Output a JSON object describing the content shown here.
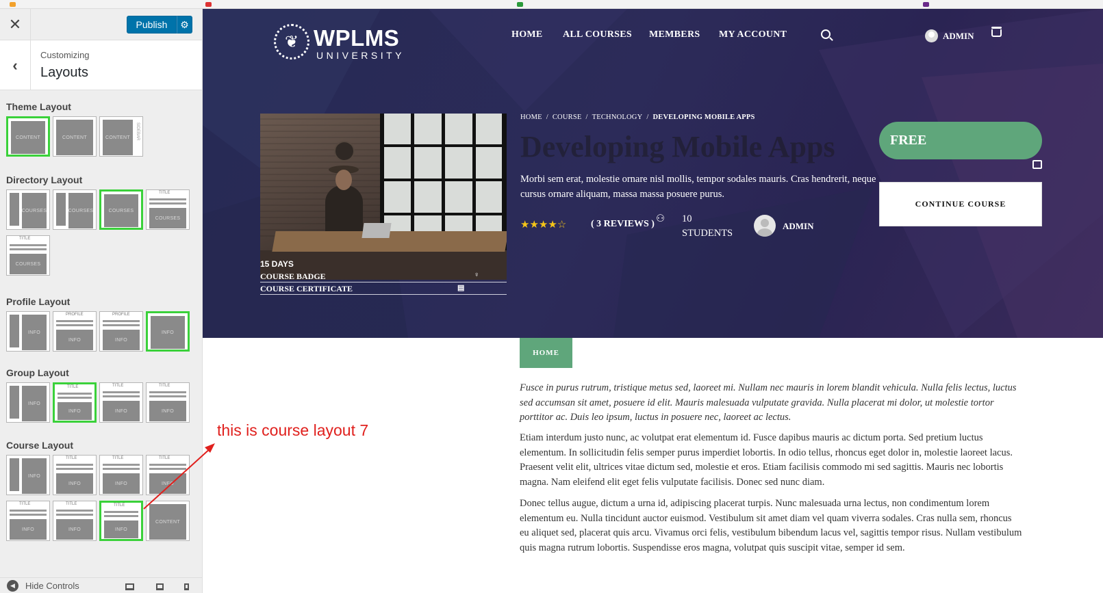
{
  "customizer": {
    "close_icon": "close-icon",
    "publish_label": "Publish",
    "settings_icon": "gear-icon",
    "back_icon": "chevron-left-icon",
    "crumb": "Customizing",
    "title": "Layouts",
    "sections": [
      {
        "label": "Theme Layout",
        "options": [
          {
            "text": "CONTENT",
            "selected": true
          },
          {
            "text": "CONTENT",
            "selected": false
          },
          {
            "text": "CONTENT",
            "selected": false,
            "side_text": "SIDEBAR"
          }
        ]
      },
      {
        "label": "Directory Layout",
        "options": [
          {
            "text": "COURSES",
            "selected": false
          },
          {
            "text": "COURSES",
            "selected": false
          },
          {
            "text": "COURSES",
            "selected": true
          },
          {
            "text": "COURSES",
            "title": "TITLE",
            "selected": false
          },
          {
            "text": "COURSES",
            "title": "TITLE",
            "selected": false
          }
        ]
      },
      {
        "label": "Profile Layout",
        "options": [
          {
            "text": "INFO",
            "selected": false
          },
          {
            "text": "INFO",
            "title": "PROFILE",
            "selected": false
          },
          {
            "text": "INFO",
            "title": "PROFILE",
            "selected": false
          },
          {
            "text": "INFO",
            "selected": true
          }
        ]
      },
      {
        "label": "Group Layout",
        "options": [
          {
            "text": "INFO",
            "selected": false
          },
          {
            "text": "INFO",
            "title": "TITLE",
            "selected": true
          },
          {
            "text": "INFO",
            "title": "TITLE",
            "selected": false
          },
          {
            "text": "INFO",
            "title": "TITLE",
            "selected": false
          }
        ]
      },
      {
        "label": "Course Layout",
        "options": [
          {
            "text": "INFO",
            "selected": false
          },
          {
            "text": "INFO",
            "title": "TITLE",
            "selected": false
          },
          {
            "text": "INFO",
            "title": "TITLE",
            "selected": false
          },
          {
            "text": "INFO",
            "title": "TITLE",
            "selected": false
          },
          {
            "text": "INFO",
            "title": "TITLE",
            "selected": false
          },
          {
            "text": "INFO",
            "title": "TITLE",
            "selected": false
          },
          {
            "text": "INFO",
            "title": "TITLE",
            "selected": true
          },
          {
            "text": "CONTENT",
            "selected": false
          }
        ]
      }
    ],
    "hide_controls": "Hide Controls"
  },
  "site": {
    "logo_name": "WPLMS",
    "logo_sub": "UNIVERSITY",
    "nav": [
      "HOME",
      "ALL COURSES",
      "MEMBERS",
      "MY ACCOUNT"
    ],
    "search_icon": "search-icon",
    "user": "ADMIN",
    "cart_icon": "cart-icon"
  },
  "course": {
    "duration": "15 DAYS",
    "badge": "COURSE BADGE",
    "certificate": "COURSE CERTIFICATE",
    "breadcrumb": [
      "HOME",
      "COURSE",
      "TECHNOLOGY",
      "DEVELOPING MOBILE APPS"
    ],
    "title": "Developing Mobile Apps",
    "description": "Morbi sem erat, molestie ornare nisl mollis, tempor sodales mauris. Cras hendrerit, neque cursus ornare aliquam, massa massa posuere purus.",
    "rating": 4,
    "rating_max": 5,
    "reviews": "( 3 REVIEWS )",
    "students_count": "10",
    "students_label": "STUDENTS",
    "instructor": "ADMIN",
    "price": "FREE",
    "continue_label": "CONTINUE COURSE",
    "tab_home": "HOME",
    "para_italic": "Fusce in purus rutrum, tristique metus sed, laoreet mi. Nullam nec mauris in lorem blandit vehicula. Nulla felis lectus, luctus sed accumsan sit amet, posuere id elit. Mauris malesuada vulputate gravida. Nulla placerat mi dolor, ut molestie tortor porttitor ac. Duis leo ipsum, luctus in posuere nec, laoreet ac lectus.",
    "para_1": "Etiam interdum justo nunc, ac volutpat erat elementum id. Fusce dapibus mauris ac dictum porta. Sed pretium luctus elementum. In sollicitudin felis semper purus imperdiet lobortis. In odio tellus, rhoncus eget dolor in, molestie laoreet lacus. Praesent velit elit, ultrices vitae dictum sed, molestie et eros. Etiam facilisis commodo mi sed sagittis. Mauris nec lobortis magna. Nam eleifend elit eget felis vulputate facilisis. Donec sed nunc diam.",
    "para_2": "Donec tellus augue, dictum a urna id, adipiscing placerat turpis. Nunc malesuada urna lectus, non condimentum lorem elementum eu. Nulla tincidunt auctor euismod. Vestibulum sit amet diam vel quam viverra sodales. Cras nulla sem, rhoncus eu aliquet sed, placerat quis arcu. Vivamus orci felis, vestibulum bibendum lacus vel, sagittis tempor risus. Nullam vestibulum quis magna rutrum lobortis. Suspendisse eros magna, volutpat quis suscipit vitae, semper id sem."
  },
  "annotation": {
    "text": "this is course layout 7",
    "color": "#e0201d"
  },
  "colors": {
    "accent_green": "#5fa67b",
    "publish_blue": "#0073aa",
    "selected_outline": "#3ad13a",
    "hero_bg": "#2a2a55"
  }
}
